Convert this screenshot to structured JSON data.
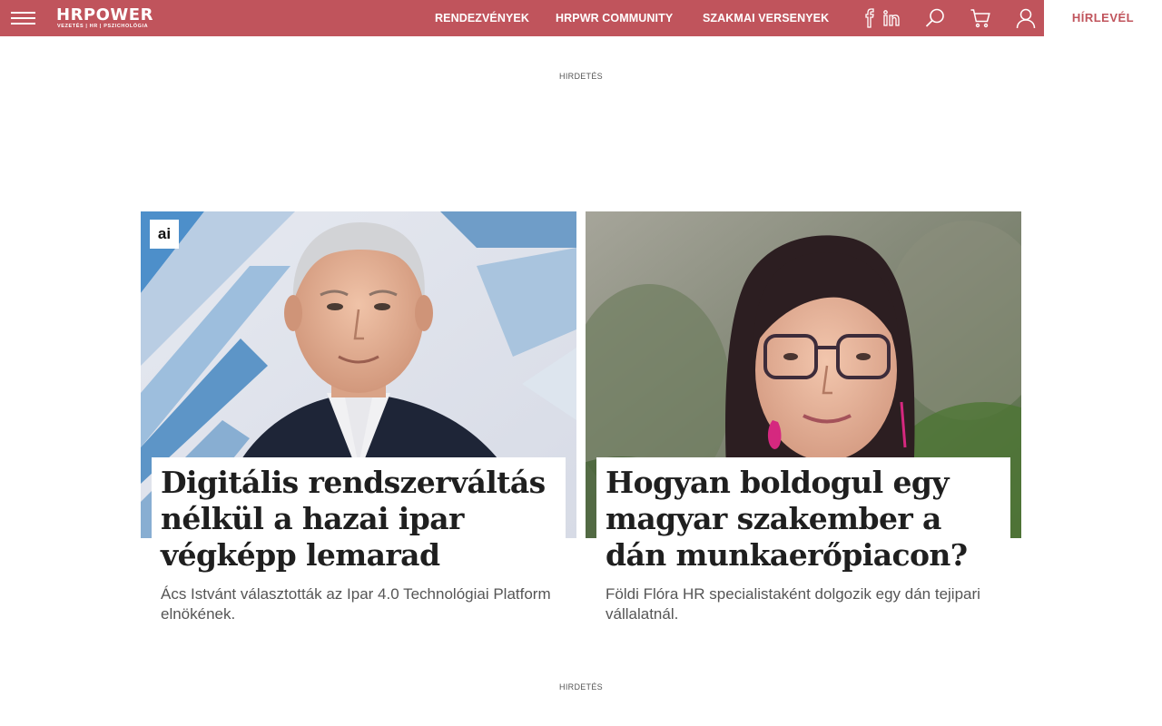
{
  "header": {
    "logo_text": "HRPOWER",
    "logo_tagline": "VEZETÉS | HR | PSZICHOLÓGIA",
    "nav": [
      "RENDEZVÉNYEK",
      "HRPWR COMMUNITY",
      "SZAKMAI VERSENYEK"
    ],
    "icons": [
      "facebook-icon",
      "linkedin-icon",
      "search-icon",
      "cart-icon",
      "user-icon"
    ],
    "newsletter_label": "HÍRLEVÉL"
  },
  "ads": {
    "top_label": "HIRDETÉS",
    "bottom_label": "HIRDETÉS"
  },
  "articles": [
    {
      "badge": "ai",
      "title": "Digitális rendszerváltás nélkül a hazai ipar végképp lemarad",
      "lead": "Ács Istvánt választották az Ipar 4.0 Technológiai Platform elnökének."
    },
    {
      "title": "Hogyan boldogul egy magyar szakember a dán munkaerőpiacon?",
      "lead": "Földi Flóra HR specialistaként dolgozik egy dán tejipari vállalatnál."
    }
  ],
  "colors": {
    "brand": "#c0545c",
    "text": "#1f1f1f",
    "muted": "#555555"
  }
}
